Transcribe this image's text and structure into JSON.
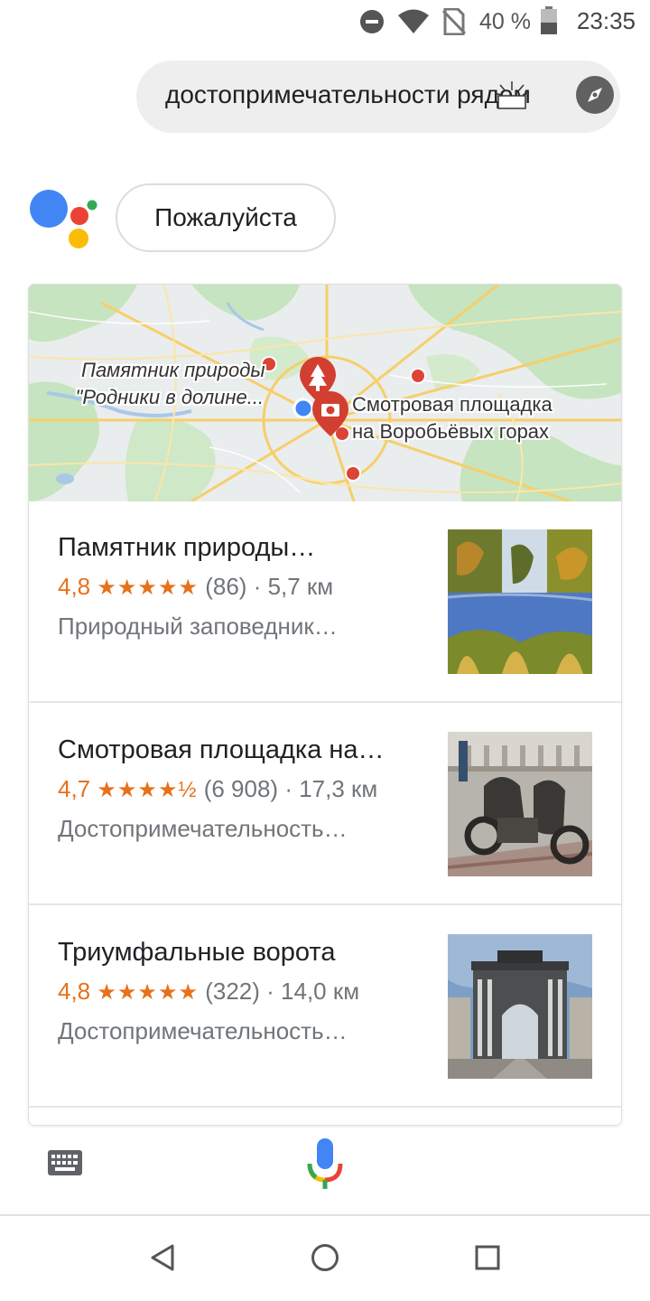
{
  "status_bar": {
    "battery_text": "40 %",
    "time": "23:35",
    "icons": [
      "do-not-disturb-icon",
      "wifi-icon",
      "no-sim-icon",
      "battery-icon"
    ]
  },
  "query": {
    "text": "достопримечательности рядом",
    "icon": "compass-icon"
  },
  "assistant": {
    "reply": "Пожалуйста",
    "logo": "google-assistant-logo"
  },
  "map": {
    "label_1_line_1": "Памятник природы",
    "label_1_line_2": "\"Родники в долине...",
    "label_2_line_1": "Смотровая площадка",
    "label_2_line_2": "на Воробьёвых горах",
    "colors": {
      "land": "#e9eef0",
      "forest": "#c8e6c1",
      "roads": "#f7d27a",
      "pin": "#db4437"
    }
  },
  "places": [
    {
      "name": "Памятник природы…",
      "score": "4,8",
      "stars": "★★★★★",
      "rating_level": 4.8,
      "reviews": "(86)",
      "distance": "· 5,7 км",
      "type": "Природный заповедник…",
      "thumb": "river-photo"
    },
    {
      "name": "Смотровая площадка на…",
      "score": "4,7",
      "stars": "★★★★½",
      "rating_level": 4.7,
      "reviews": "(6 908)",
      "distance": "· 17,3 км",
      "type": "Достопримечательность…",
      "thumb": "motorcycles-photo"
    },
    {
      "name": "Триумфальные ворота",
      "score": "4,8",
      "stars": "★★★★★",
      "rating_level": 4.8,
      "reviews": "(322)",
      "distance": "· 14,0 км",
      "type": "Достопримечательность…",
      "thumb": "triumphal-arch-photo"
    }
  ],
  "bottom": {
    "keyboard_icon": "keyboard-icon",
    "mic_icon": "microphone-icon"
  },
  "nav": [
    "back-icon",
    "home-icon",
    "recents-icon"
  ]
}
